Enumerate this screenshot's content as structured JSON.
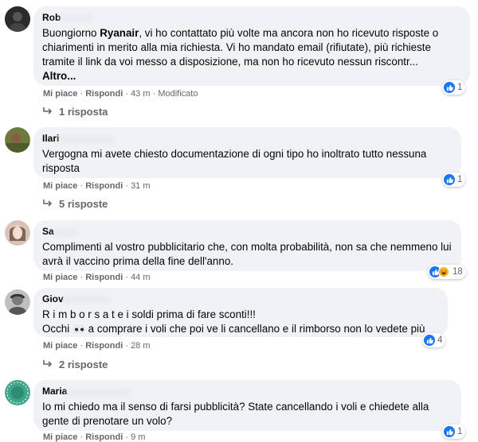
{
  "ui": {
    "like_label": "Mi piace",
    "reply_label": "Rispondi",
    "dot_sep": "·",
    "colors": {
      "bubble": "#f0f2f5",
      "meta": "#65676b",
      "like_blue": "#1877f2",
      "haha_yellow": "#f7b125"
    }
  },
  "comments": [
    {
      "author": "Rob",
      "text_before": "Buongiorno ",
      "text_bold": "Ryanair",
      "text_after": ", vi ho contattato più volte ma ancora non ho ricevuto risposte o chiarimenti in merito alla mia richiesta. Vi ho mandato email (rifiutate), più richieste tramite il link da voi messo a disposizione, ma non ho ricevuto nessun riscontr...",
      "more": "Altro...",
      "time": "43 m",
      "edited": "Modificato",
      "reactions": {
        "icons": [
          "like-icon"
        ],
        "count": "1"
      },
      "replies": "1 risposta"
    },
    {
      "author": "Ilari",
      "text": "Vergogna mi avete chiesto documentazione di ogni tipo ho inoltrato tutto nessuna risposta",
      "time": "31 m",
      "reactions": {
        "icons": [
          "like-icon"
        ],
        "count": "1"
      },
      "replies": "5 risposte"
    },
    {
      "author": "Sa",
      "text": "Complimenti al vostro pubblicitario che, con molta probabilità, non sa che nemmeno lui avrà il vaccino prima della fine dell'anno.",
      "time": "44 m",
      "reactions": {
        "icons": [
          "like-icon",
          "haha-icon"
        ],
        "count": "18"
      },
      "replies": ""
    },
    {
      "author": "Giov",
      "line1": "R i m b o r s a t e i soldi prima di fare sconti!!!",
      "line2_before": "Occhi ",
      "line2_after": " a comprare i voli che poi ve li cancellano e il rimborso non lo vedete più",
      "time": "28 m",
      "reactions": {
        "icons": [
          "like-icon"
        ],
        "count": "4"
      },
      "replies": "2 risposte"
    },
    {
      "author": "Maria",
      "text": "Io mi chiedo ma il senso di farsi pubblicità? State cancellando i voli e chiedete alla gente di prenotare un volo?",
      "time": "9 m",
      "reactions": {
        "icons": [
          "like-icon"
        ],
        "count": "1"
      },
      "replies": ""
    }
  ]
}
